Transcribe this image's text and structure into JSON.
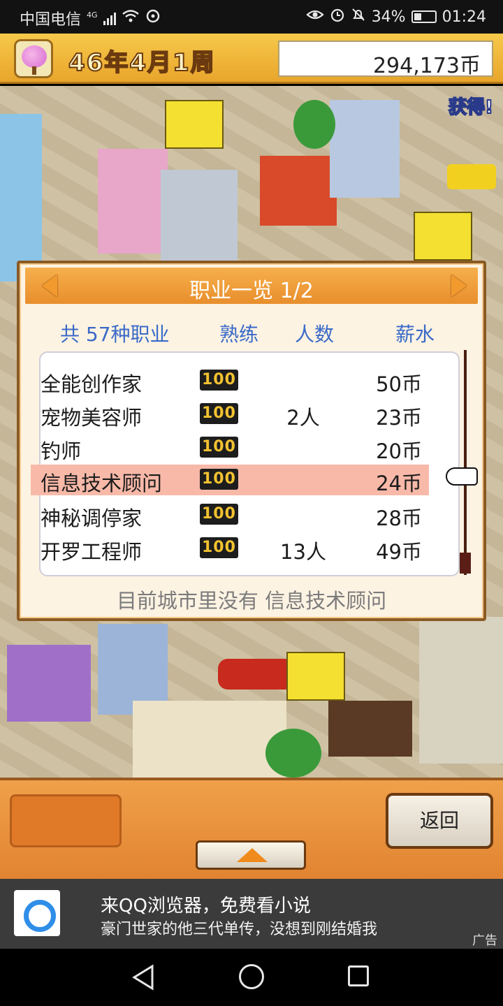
{
  "status_bar": {
    "carrier": "中国电信",
    "network": "4G",
    "battery": "34%",
    "battery_level": 0.34,
    "time": "01:24",
    "icons": [
      "signal-icon",
      "wifi-icon",
      "hotspot-icon",
      "eye-icon",
      "alarm-icon",
      "mute-icon",
      "battery-icon"
    ]
  },
  "game_bar": {
    "date": "46年4月1周",
    "money": "294,173币",
    "get_label": "获得!"
  },
  "dialog": {
    "title": "职业一览 1/2",
    "columns": {
      "total": "共 57种职业",
      "skill": "熟练",
      "count": "人数",
      "salary": "薪水"
    },
    "rows": [
      {
        "name": "全能创作家",
        "level": "100",
        "count": "",
        "salary": "50币",
        "selected": false
      },
      {
        "name": "宠物美容师",
        "level": "100",
        "count": "2人",
        "salary": "23币",
        "selected": false
      },
      {
        "name": "钓师",
        "level": "100",
        "count": "",
        "salary": "20币",
        "selected": false
      },
      {
        "name": "信息技术顾问",
        "level": "100",
        "count": "",
        "salary": "24币",
        "selected": true
      },
      {
        "name": "神秘调停家",
        "level": "100",
        "count": "",
        "salary": "28币",
        "selected": false
      },
      {
        "name": "开罗工程师",
        "level": "100",
        "count": "13人",
        "salary": "49币",
        "selected": false
      }
    ],
    "message": "目前城市里没有 信息技术顾问"
  },
  "bottom_panel": {
    "back_label": "返回"
  },
  "ad": {
    "title": "来QQ浏览器，免费看小说",
    "subtitle": "豪门世家的他三代单传，没想到刚结婚我",
    "tag": "广告"
  },
  "colors": {
    "accent_orange": "#e88e2c",
    "column_header_blue": "#3a6ac8",
    "selected_row": "#f8b9a8"
  }
}
